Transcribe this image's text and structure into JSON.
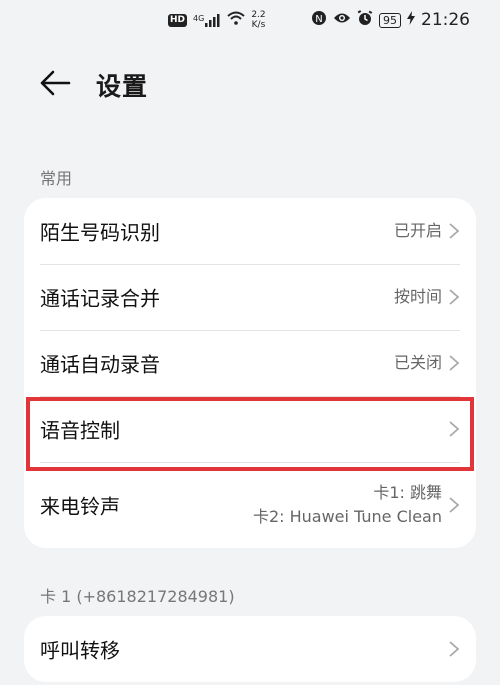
{
  "status_bar": {
    "hd": "HD",
    "network": "4G",
    "speed_value": "2.2",
    "speed_unit": "K/s",
    "battery": "95",
    "time": "21:26"
  },
  "header": {
    "title": "设置"
  },
  "sections": [
    {
      "label": "常用",
      "items": [
        {
          "title": "陌生号码识别",
          "value": "已开启"
        },
        {
          "title": "通话记录合并",
          "value": "按时间"
        },
        {
          "title": "通话自动录音",
          "value": "已关闭"
        },
        {
          "title": "语音控制",
          "value": ""
        },
        {
          "title": "来电铃声",
          "value_line1": "卡1: 跳舞",
          "value_line2": "卡2: Huawei Tune Clean"
        }
      ]
    },
    {
      "label": "卡 1 (+8618217284981)",
      "items": [
        {
          "title": "呼叫转移",
          "value": ""
        }
      ]
    }
  ],
  "colors": {
    "background": "#f1f3f5",
    "card": "#ffffff",
    "highlight": "#e2353a"
  }
}
